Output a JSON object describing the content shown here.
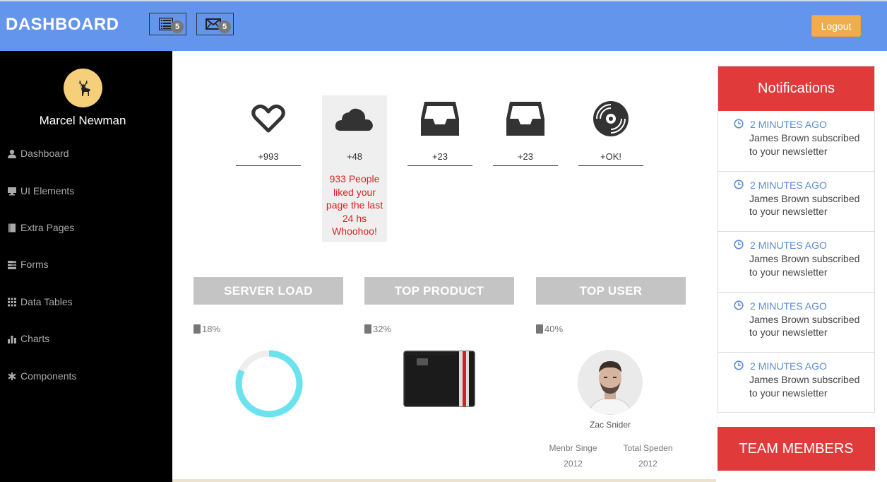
{
  "header": {
    "brand": "DASHBOARD",
    "tasks_icon": "list-icon",
    "tasks_badge": "5",
    "mail_icon": "envelope-icon",
    "mail_badge": "5",
    "logout_label": "Logout",
    "bar_color": "#6495ED",
    "logout_color": "#F0AD4E"
  },
  "sidebar": {
    "avatar_icon": "deer-icon",
    "user_name": "Marcel Newman",
    "items": [
      {
        "label": "Dashboard",
        "icon": "user-icon"
      },
      {
        "label": "UI Elements",
        "icon": "desktop-icon"
      },
      {
        "label": "Extra Pages",
        "icon": "book-icon"
      },
      {
        "label": "Forms",
        "icon": "tasks-icon"
      },
      {
        "label": "Data Tables",
        "icon": "grid-icon"
      },
      {
        "label": "Charts",
        "icon": "bar-chart-icon"
      },
      {
        "label": "Components",
        "icon": "asterisk-icon"
      }
    ]
  },
  "stats": [
    {
      "icon": "heart-icon",
      "value": "+993"
    },
    {
      "icon": "cloud-icon",
      "value": "+48",
      "message_lines": [
        "933 People",
        "liked your",
        "page the last",
        "24 hs",
        "Whoohoo!"
      ]
    },
    {
      "icon": "inbox-icon",
      "value": "+23"
    },
    {
      "icon": "inbox-icon",
      "value": "+23"
    },
    {
      "icon": "vinyl-icon",
      "value": "+OK!"
    }
  ],
  "panels": {
    "server_load": {
      "title": "SERVER LOAD",
      "percent": "18%",
      "donut_fill_fraction": 0.82,
      "donut_color": "#6BE3EF"
    },
    "top_product": {
      "title": "TOP PRODUCT",
      "percent": "32%",
      "image": "wallet-image"
    },
    "top_user": {
      "title": "TOP USER",
      "percent": "40%",
      "image": "user-photo",
      "name": "Zac Snider",
      "col1_label": "Menbr Singe",
      "col1_value": "2012",
      "col2_label": "Total Speden",
      "col2_value": "2012"
    }
  },
  "notifications": {
    "title": "Notifications",
    "items": [
      {
        "time": "2 MINUTES AGO",
        "line1": "James Brown subscribed",
        "line2": "to your newsletter"
      },
      {
        "time": "2 MINUTES AGO",
        "line1": "James Brown subscribed",
        "line2": "to your newsletter"
      },
      {
        "time": "2 MINUTES AGO",
        "line1": "James Brown subscribed",
        "line2": "to your newsletter"
      },
      {
        "time": "2 MINUTES AGO",
        "line1": "James Brown subscribed",
        "line2": "to your newsletter"
      },
      {
        "time": "2 MINUTES AGO",
        "line1": "James Brown subscribed",
        "line2": "to your newsletter"
      }
    ]
  },
  "team": {
    "title": "TEAM MEMBERS",
    "header_color": "#E03A3A"
  }
}
